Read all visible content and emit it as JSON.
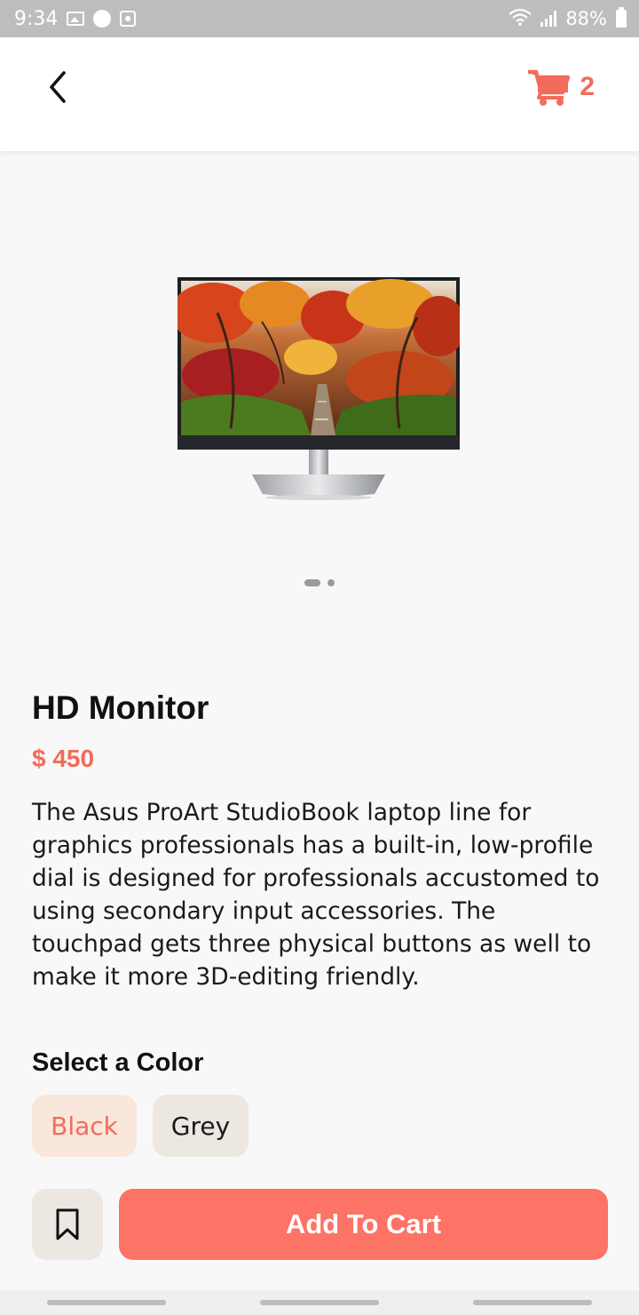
{
  "status_bar": {
    "time": "9:34",
    "battery_percent": "88%",
    "icons": [
      "gallery-icon",
      "notification-icon",
      "screenshot-icon",
      "wifi-icon",
      "signal-icon",
      "battery-icon"
    ]
  },
  "header": {
    "back_icon": "chevron-left-icon",
    "cart_icon": "shopping-cart-icon",
    "cart_count": "2"
  },
  "gallery": {
    "image": "monitor-image",
    "slides": 2,
    "active_slide": 1
  },
  "product": {
    "name": "HD Monitor",
    "price": "$ 450",
    "description": "The Asus ProArt StudioBook laptop line for graphics professionals has a built-in, low-profile dial is designed for professionals accustomed to using secondary input accessories. The touchpad gets three physical buttons as well to make it more 3D-editing friendly."
  },
  "color_select": {
    "heading": "Select a Color",
    "options": [
      {
        "label": "Black",
        "selected": true
      },
      {
        "label": "Grey",
        "selected": false
      }
    ]
  },
  "actions": {
    "bookmark_icon": "bookmark-icon",
    "add_to_cart_label": "Add To Cart"
  },
  "colors": {
    "accent": "#f26b5b",
    "button": "#fd7366",
    "chip_selected_bg": "#f8e7da",
    "chip_bg": "#ece8e1",
    "background": "#f8f8f8"
  }
}
